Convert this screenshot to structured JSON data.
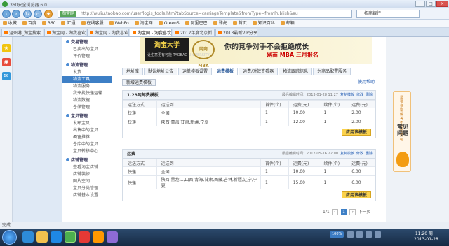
{
  "browser": {
    "title": "360安全浏览器 6.0",
    "url_site": "淘宝网",
    "url": "http://wuliu.taobao.com/user/logis_tools.htm?tabSource=carriageTemplate&fromType=fromPublish&au",
    "bank": "招商银行",
    "bookmarks": [
      "收藏",
      "百度",
      "360",
      "汇通",
      "在线客服",
      "WebPo",
      "淘宝网",
      "GreenS",
      "阿里巴巴",
      "雅虎",
      "首页",
      "知识百科",
      "邮箱"
    ],
    "tabs": [
      "温州港_淘宝搜索",
      "淘宝网 - 淘我喜欢",
      "淘宝网 - 淘我喜欢！",
      "淘宝网 - 淘我喜欢！",
      "2012年度北京新",
      "2013最新VIP分享"
    ],
    "active_tab": 3,
    "status": "完成",
    "zoom": "100%"
  },
  "sidenav": {
    "sections": [
      {
        "title": "交易管理",
        "items": [
          "已卖出的宝贝",
          "评价管理"
        ]
      },
      {
        "title": "物流管理",
        "items": [
          "发货",
          "物流工具",
          "物流服务",
          "我来找快递运输",
          "物流数据",
          "仓储管理"
        ]
      },
      {
        "title": "宝贝管理",
        "items": [
          "发布宝贝",
          "出售中的宝贝",
          "橱窗推荐",
          "仓库中的宝贝",
          "宝贝转移中心"
        ]
      },
      {
        "title": "店铺管理",
        "items": [
          "查看淘宝店铺",
          "店铺装修",
          "图片空间",
          "宝贝分类管理",
          "店铺基本设置"
        ]
      }
    ],
    "selected": "物流工具"
  },
  "banner": {
    "logo": "淘宝大学",
    "logo_sub": "让生意更有可能 TAOBAO UNIVERSITY",
    "mba": "网商 MBA",
    "slogan": "你的竞争对手不会拒绝成长",
    "slogan2": "网商 MBA 三月报名"
  },
  "subtabs": [
    "地址库",
    "默认地址公告",
    "运单模板设置",
    "运费模板",
    "运费/时效查看器",
    "物流跟踪信息",
    "为商品配置服务"
  ],
  "active_subtab": 3,
  "help": "使用帮助",
  "new_template": "新增运费模板",
  "templates": [
    {
      "name": "1.28吨邮费模板",
      "updated": "最后编辑时间：2013-01-28 11:27",
      "actions": [
        "复制模板",
        "修改",
        "删除"
      ],
      "columns": [
        "运送方式",
        "运送到",
        "首件(个)",
        "运费(元)",
        "续件(个)",
        "运费(元)"
      ],
      "rows": [
        [
          "快递",
          "全国",
          "1",
          "10.00",
          "1",
          "2.00"
        ],
        [
          "快递",
          "陕西,青海,甘肃,新疆,宁夏",
          "1",
          "12.00",
          "1",
          "2.00"
        ]
      ],
      "apply": "应用该模板"
    },
    {
      "name": "运费",
      "updated": "最后编辑时间：2012-05-16 22:00",
      "actions": [
        "复制模板",
        "修改",
        "删除"
      ],
      "columns": [
        "运送方式",
        "运送到",
        "首件(个)",
        "运费(元)",
        "续件(个)",
        "运费(元)"
      ],
      "rows": [
        [
          "快递",
          "全国",
          "1",
          "10.00",
          "1",
          "6.00"
        ],
        [
          "快递",
          "陕西,黑龙江,山西,青海,甘肃,西藏,吉林,新疆,辽宁,宁夏",
          "1",
          "15.00",
          "1",
          "6.00"
        ]
      ],
      "apply": "应用该模板"
    }
  ],
  "pager": {
    "summary": "1/1",
    "prev": "上一页",
    "pages": [
      "1"
    ],
    "next": "下一页"
  },
  "faq": {
    "side_text": "需要亲帮解答不再犹豫吧",
    "title": "常见问题"
  },
  "taskbar": {
    "time": "11:20 周一",
    "date": "2013-01-28"
  }
}
